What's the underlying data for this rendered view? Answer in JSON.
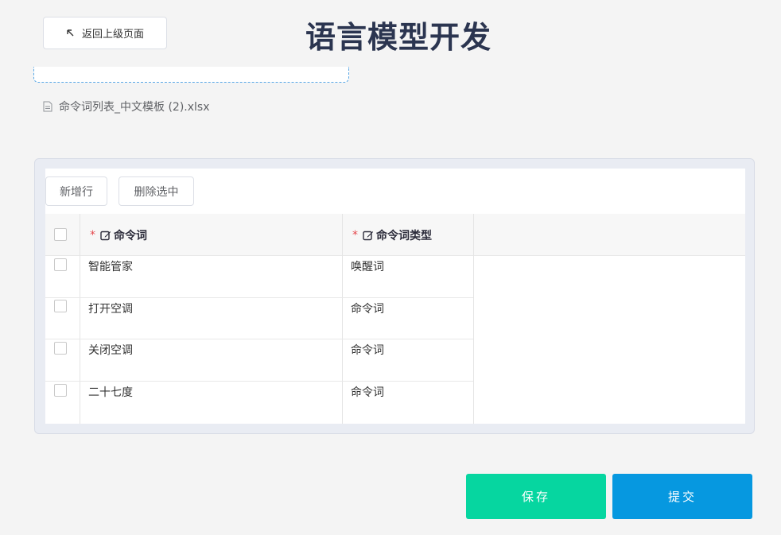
{
  "header": {
    "back_label": "返回上级页面",
    "title": "语言模型开发"
  },
  "upload": {
    "file_name": "命令词列表_中文模板 (2).xlsx"
  },
  "table": {
    "toolbar": {
      "add_row": "新增行",
      "delete_selected": "删除选中"
    },
    "columns": [
      {
        "label": "命令词",
        "required_mark": "*"
      },
      {
        "label": "命令词类型",
        "required_mark": "*"
      }
    ],
    "rows": [
      {
        "word": "智能管家",
        "type": "唤醒词"
      },
      {
        "word": "打开空调",
        "type": "命令词"
      },
      {
        "word": "关闭空调",
        "type": "命令词"
      },
      {
        "word": "二十七度",
        "type": "命令词"
      }
    ]
  },
  "actions": {
    "save": "保存",
    "submit": "提交"
  },
  "colors": {
    "save": "#06d6a0",
    "submit": "#0698e0",
    "title": "#2b3550",
    "required": "#e5484d"
  },
  "icons": {
    "back": "arrow-up-left-icon",
    "file": "document-icon",
    "edit": "edit-icon"
  }
}
